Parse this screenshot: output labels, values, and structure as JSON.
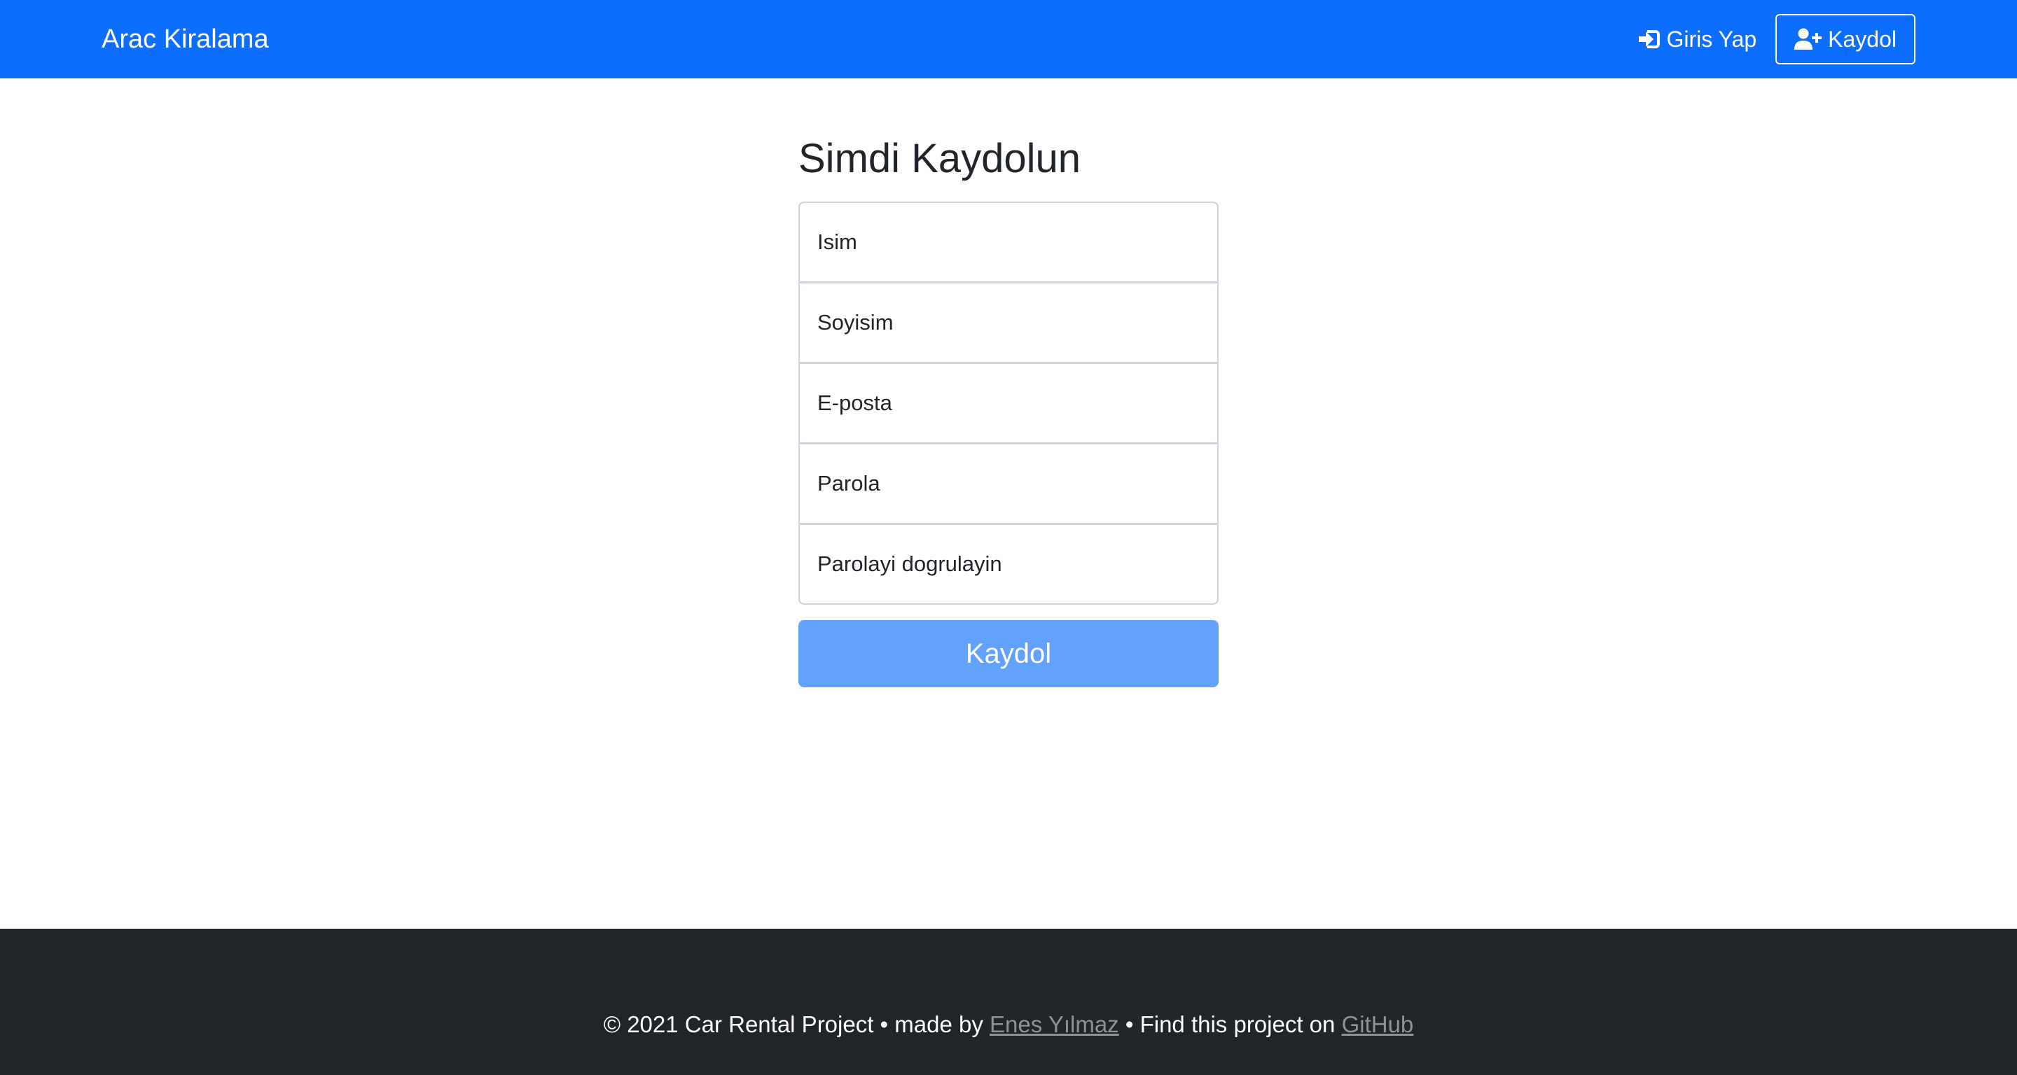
{
  "navbar": {
    "brand": "Arac Kiralama",
    "login_label": "Giris Yap",
    "login_icon": "sign-in-icon",
    "register_label": "Kaydol",
    "register_icon": "user-plus-icon"
  },
  "main": {
    "title": "Simdi Kaydolun",
    "fields": {
      "first_name": {
        "placeholder": "Isim",
        "value": ""
      },
      "last_name": {
        "placeholder": "Soyisim",
        "value": ""
      },
      "email": {
        "placeholder": "E-posta",
        "value": ""
      },
      "password": {
        "placeholder": "Parola",
        "value": ""
      },
      "password_confirm": {
        "placeholder": "Parolayi dogrulayin",
        "value": ""
      }
    },
    "submit_label": "Kaydol"
  },
  "footer": {
    "copyright": "© 2021 Car Rental Project • made by",
    "author_link": "Enes Yılmaz",
    "find_text": "• Find this project on",
    "github_link": "GitHub"
  },
  "colors": {
    "navbar_bg": "#0d6efd",
    "submit_bg": "#62a2fc",
    "footer_bg": "#212529",
    "footer_link": "#8e9196"
  }
}
